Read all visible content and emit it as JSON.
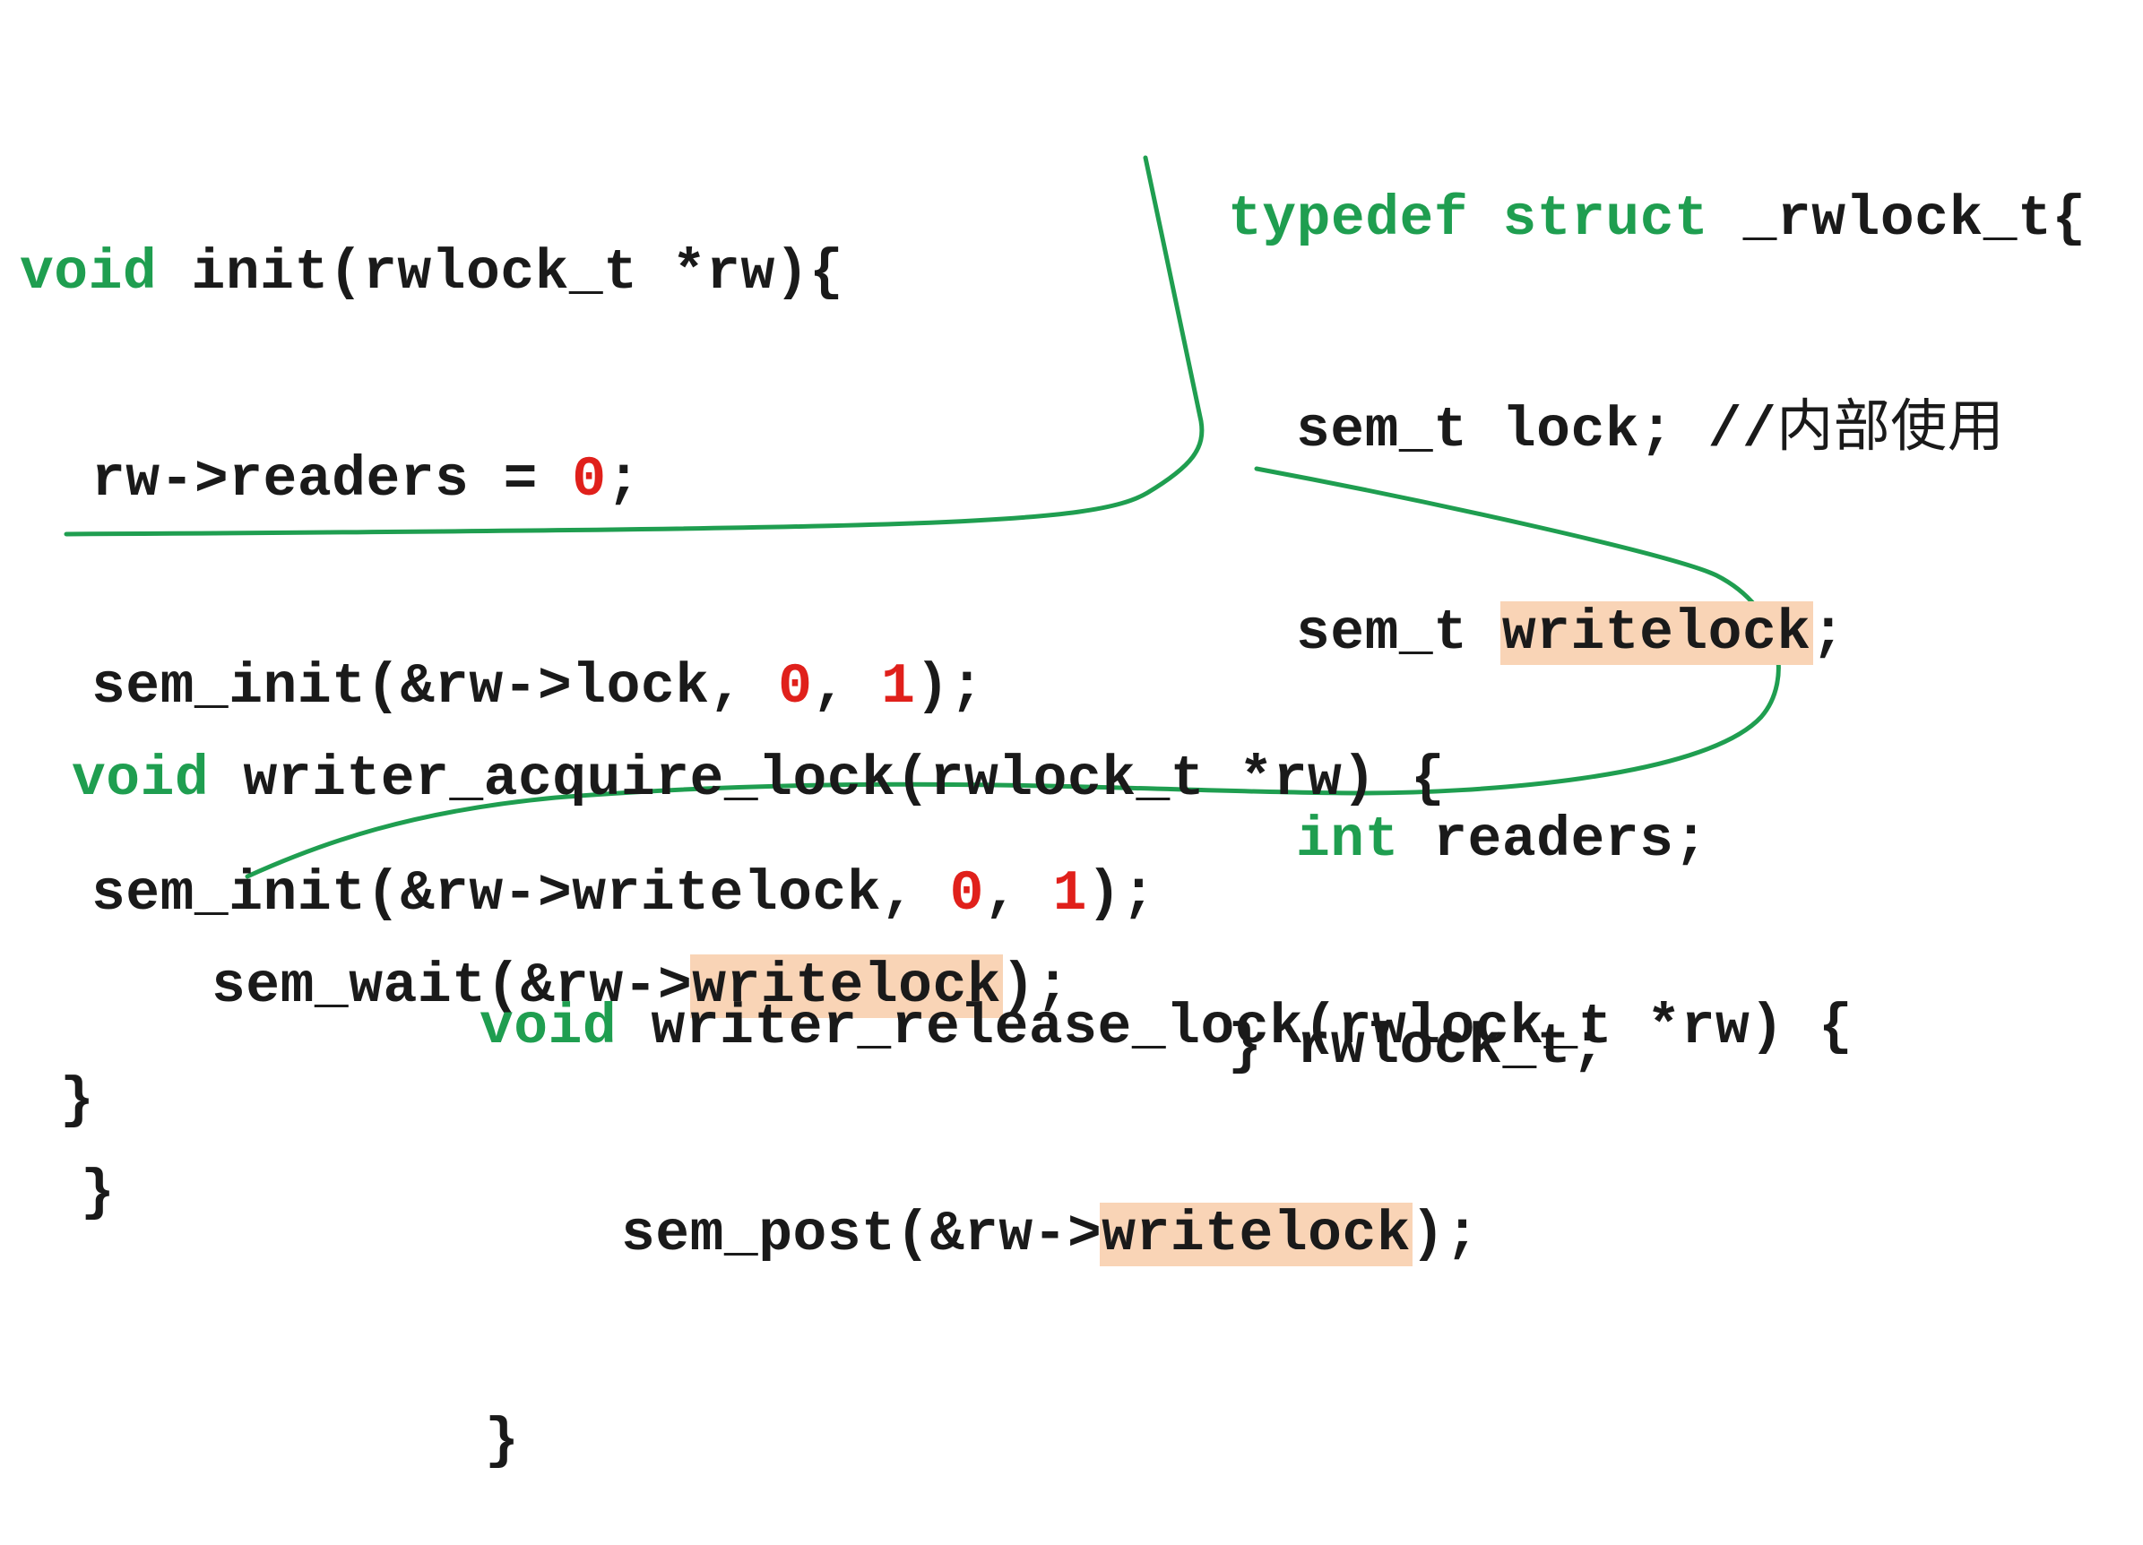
{
  "colors": {
    "keyword": "#1f9e50",
    "number": "#e0201b",
    "highlight": "#f9d4b6",
    "divider": "#1f9e50",
    "text": "#1a1a1a"
  },
  "init_block": {
    "l1_kw": "void",
    "l1_rest": " init(rwlock_t *rw){",
    "l2_a": "rw->readers = ",
    "l2_num": "0",
    "l2_b": ";",
    "l3_a": "sem_init(&rw->lock, ",
    "l3_n1": "0",
    "l3_sep": ", ",
    "l3_n2": "1",
    "l3_b": ");",
    "l4_a": "sem_init(&rw->writelock, ",
    "l4_n1": "0",
    "l4_sep": ", ",
    "l4_n2": "1",
    "l4_b": ");",
    "l5": "}"
  },
  "struct_block": {
    "l1_kw1": "typedef",
    "l1_kw2": "struct",
    "l1_rest": "_rwlock_t{",
    "l2_code": "sem_t lock; //",
    "l2_comment": "内部使用",
    "l3_a": "sem_t ",
    "l3_hl": "writelock",
    "l3_b": ";",
    "l4_kw": "int",
    "l4_rest": " readers;",
    "l5": "} rwlock_t;"
  },
  "acquire_block": {
    "l1_kw": "void",
    "l1_rest": " writer_acquire_lock(rwlock_t *rw) {",
    "l2_a": "sem_wait(&rw->",
    "l2_hl": "writelock",
    "l2_b": ");",
    "l3": "}"
  },
  "release_block": {
    "l1_kw": "void",
    "l1_rest": " writer_release_lock(rwlock_t *rw) {",
    "l2_a": "sem_post(&rw->",
    "l2_hl": "writelock",
    "l2_b": ");",
    "l3": "}"
  }
}
